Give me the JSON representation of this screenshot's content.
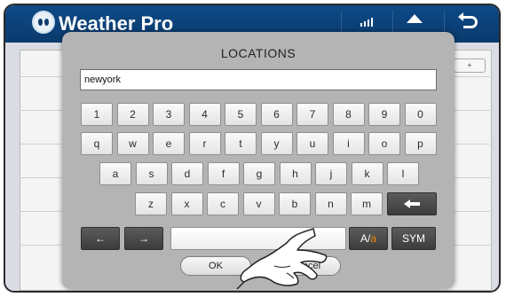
{
  "app": {
    "title": "Weather Pro",
    "add_label": "+"
  },
  "dialog": {
    "title": "LOCATIONS",
    "input_value": "newyork",
    "ok_label": "OK",
    "cancel_label": "Cancel"
  },
  "keyboard": {
    "row1": [
      "1",
      "2",
      "3",
      "4",
      "5",
      "6",
      "7",
      "8",
      "9",
      "0"
    ],
    "row2": [
      "q",
      "w",
      "e",
      "r",
      "t",
      "y",
      "u",
      "i",
      "o",
      "p"
    ],
    "row3": [
      "a",
      "s",
      "d",
      "f",
      "g",
      "h",
      "j",
      "k",
      "l"
    ],
    "row4": [
      "z",
      "x",
      "c",
      "v",
      "b",
      "n",
      "m"
    ],
    "left_arrow": "←",
    "right_arrow": "→",
    "case_label_a": "A/",
    "case_label_b": "a",
    "sym_label": "SYM"
  },
  "colors": {
    "topbar": "#0a3a6e",
    "dialog": "#b4b4b4",
    "accent": "#f08a00"
  },
  "icons": [
    "app-icon",
    "signal-icon",
    "home-icon",
    "back-icon",
    "backspace-icon",
    "hand-pointer-icon"
  ]
}
